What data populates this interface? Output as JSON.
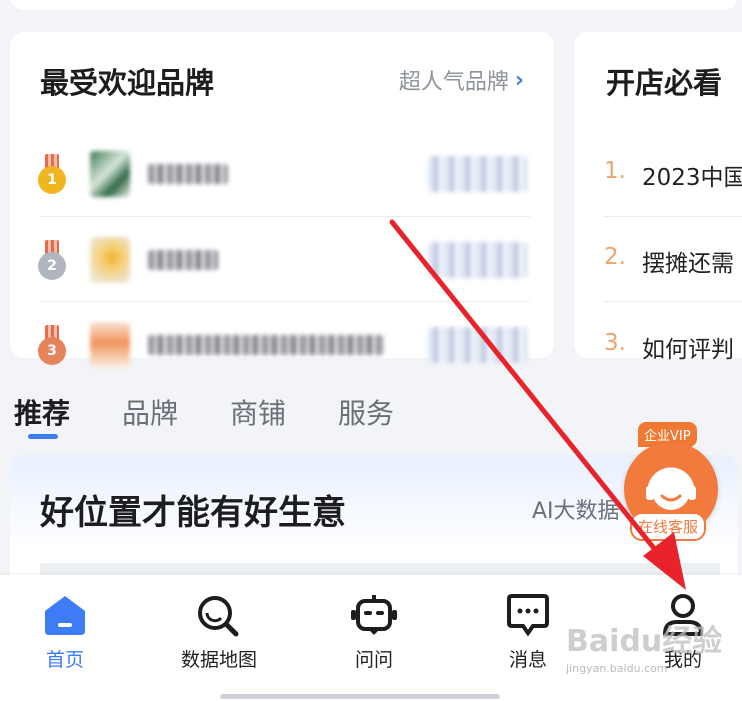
{
  "popular_brands": {
    "title": "最受欢迎品牌",
    "more_link": "超人气品牌",
    "items": [
      {
        "rank": "1",
        "medal": "gold"
      },
      {
        "rank": "2",
        "medal": "silver"
      },
      {
        "rank": "3",
        "medal": "bronze"
      }
    ]
  },
  "shop_guide": {
    "title": "开店必看",
    "items": [
      {
        "num": "1.",
        "text": "2023中国"
      },
      {
        "num": "2.",
        "text": "摆摊还需"
      },
      {
        "num": "3.",
        "text": "如何评判"
      }
    ]
  },
  "tabs": [
    "推荐",
    "品牌",
    "商铺",
    "服务"
  ],
  "active_tab": "推荐",
  "location_card": {
    "title": "好位置才能有好生意",
    "subtitle": "AI大数据"
  },
  "vip_service": {
    "tag": "企业VIP",
    "label": "在线客服"
  },
  "tabbar": [
    {
      "label": "首页",
      "icon": "home-icon",
      "active": true
    },
    {
      "label": "数据地图",
      "icon": "data-map-icon",
      "active": false
    },
    {
      "label": "问问",
      "icon": "robot-chat-icon",
      "active": false
    },
    {
      "label": "消息",
      "icon": "message-icon",
      "active": false
    },
    {
      "label": "我的",
      "icon": "user-icon",
      "active": false
    }
  ],
  "watermark": {
    "brand": "Baidu经验",
    "url": "jingyan.baidu.com"
  },
  "colors": {
    "accent_blue": "#3d7cf5",
    "vip_orange": "#f27a3d",
    "annotation_red": "#e8232b",
    "guide_number": "#f0a36b"
  }
}
